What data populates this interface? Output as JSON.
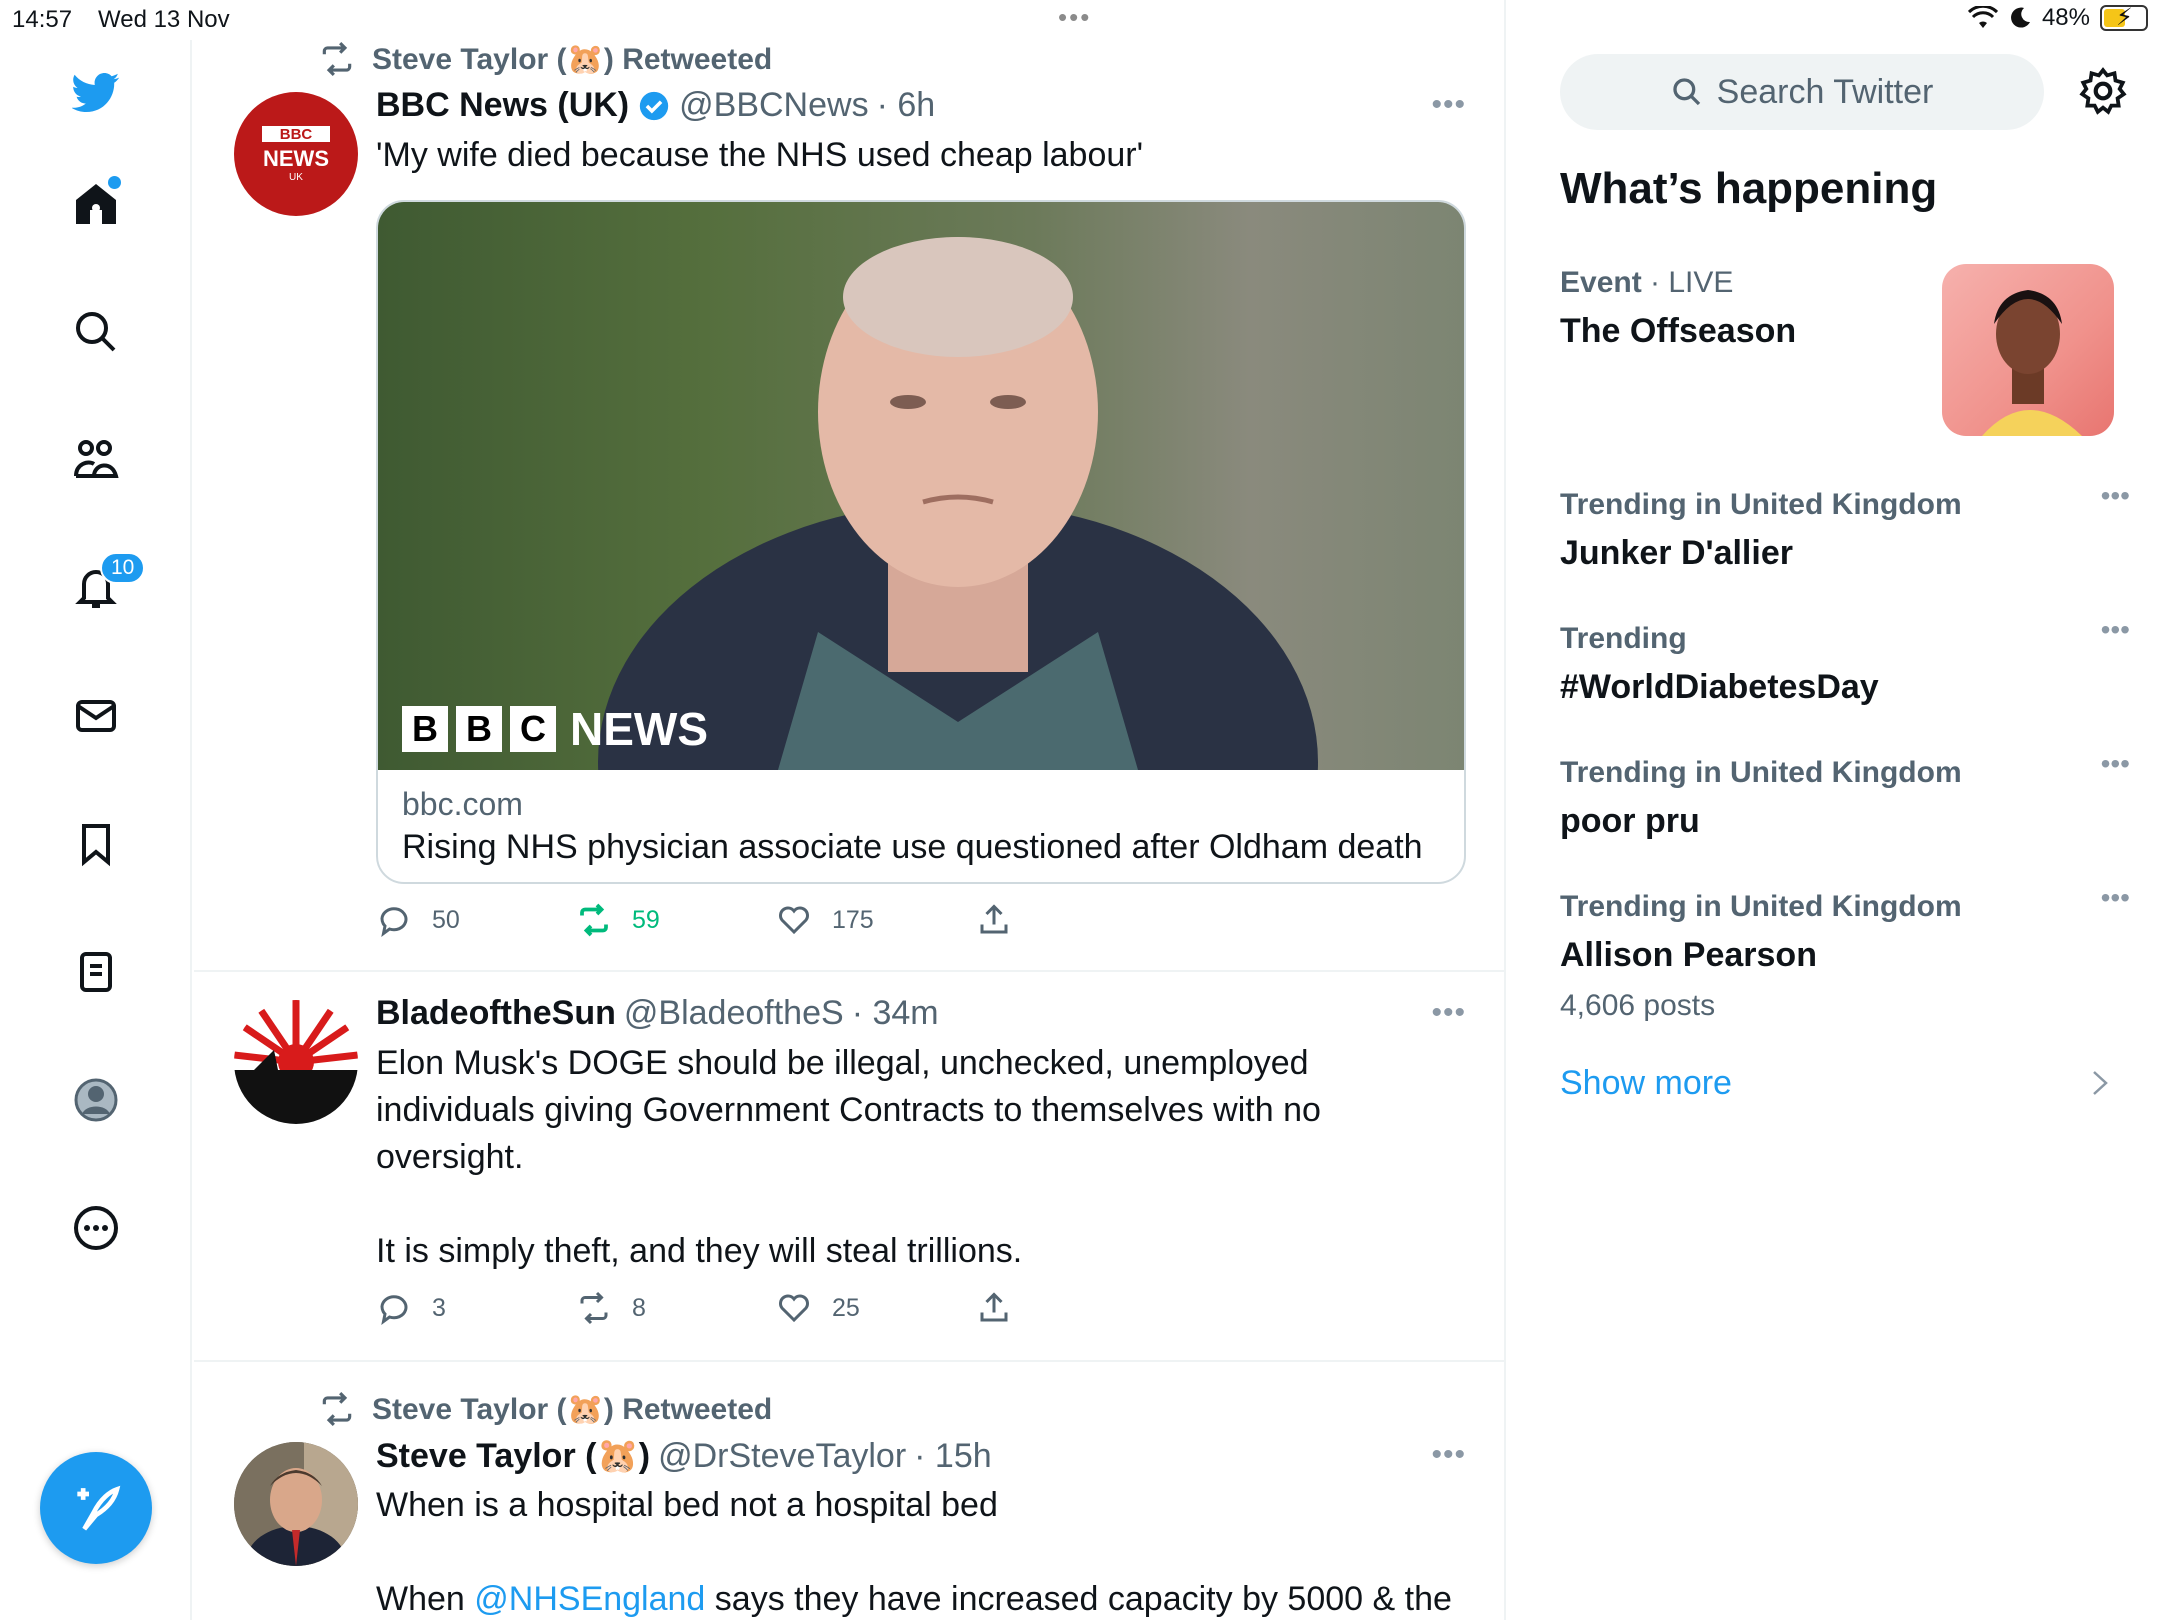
{
  "status": {
    "time": "14:57",
    "date": "Wed 13 Nov",
    "battery": "48%"
  },
  "left_rail": {
    "notifications_count": "10"
  },
  "tweets": [
    {
      "retweeted_by": "Steve Taylor (🐹) Retweeted",
      "name": "BBC News (UK)",
      "handle": "@BBCNews",
      "time": "· 6h",
      "text": "'My wife died because the NHS used cheap labour'",
      "card": {
        "domain": "bbc.com",
        "title": "Rising NHS physician associate use questioned after Oldham death",
        "logo_letters": [
          "B",
          "B",
          "C"
        ],
        "logo_word": "NEWS"
      },
      "avatar_text": {
        "top": "BBC",
        "mid": "NEWS",
        "bottom": "UK"
      },
      "replies": "50",
      "retweets": "59",
      "likes": "175"
    },
    {
      "name": "BladeoftheSun",
      "handle": "@BladeoftheS",
      "time": "· 34m",
      "text_lines": [
        "Elon Musk's DOGE should be illegal, unchecked, unemployed",
        "individuals giving Government Contracts to themselves with no",
        "oversight.",
        "",
        "It is simply theft, and they will steal trillions."
      ],
      "replies": "3",
      "retweets": "8",
      "likes": "25"
    },
    {
      "retweeted_by": "Steve Taylor (🐹) Retweeted",
      "name": "Steve Taylor (🐹)",
      "handle": "@DrSteveTaylor",
      "time": "· 15h",
      "text_line1": "When is a hospital bed not a hospital bed",
      "text_line2_pre": "When ",
      "text_line2_mention": "@NHSEngland",
      "text_line2_post": " says they have increased capacity by 5000 & the"
    }
  ],
  "sidebar": {
    "search_placeholder": "Search Twitter",
    "whats_happening": "What’s happening",
    "trends": [
      {
        "meta": "Event",
        "meta_extra": " · LIVE",
        "topic": "The Offseason"
      },
      {
        "meta": "Trending in United Kingdom",
        "topic": "Junker D'allier"
      },
      {
        "meta": "Trending",
        "topic": "#WorldDiabetesDay"
      },
      {
        "meta": "Trending in United Kingdom",
        "topic": "poor pru"
      },
      {
        "meta": "Trending in United Kingdom",
        "topic": "Allison Pearson",
        "posts": "4,606 posts"
      }
    ],
    "show_more": "Show more"
  },
  "colors": {
    "accent": "#1d9bf0",
    "retweet_green": "#00ba7c",
    "muted": "#536471"
  }
}
